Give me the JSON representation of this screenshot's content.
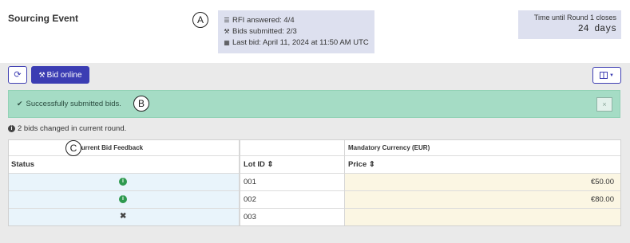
{
  "page_title": "Sourcing Event",
  "callouts": {
    "a": "A",
    "b": "B",
    "c": "C"
  },
  "summary": {
    "rfi": "RFI answered: 4/4",
    "bids": "Bids submitted: 2/3",
    "last_bid": "Last bid: April 11, 2024 at 11:50 AM UTC"
  },
  "timer": {
    "label": "Time until Round 1 closes",
    "value": "24 days"
  },
  "toolbar": {
    "bid_online_label": "Bid online"
  },
  "alert": {
    "message": "Successfully submitted bids.",
    "close_symbol": "×"
  },
  "info_note": "2 bids changed in current round.",
  "table": {
    "group_headers": {
      "feedback": "Current Bid Feedback",
      "currency": "Mandatory Currency (EUR)"
    },
    "columns": {
      "status": "Status",
      "lot_id": "Lot ID ⇕",
      "price": "Price ⇕"
    },
    "rows": [
      {
        "status": "ok",
        "lot_id": "001",
        "price": "€50.00"
      },
      {
        "status": "ok",
        "lot_id": "002",
        "price": "€80.00"
      },
      {
        "status": "none",
        "lot_id": "003",
        "price": ""
      }
    ]
  },
  "icons": {
    "list": "list-icon",
    "gavel": "gavel-icon",
    "calendar": "calendar-icon",
    "refresh": "refresh-icon",
    "columns": "columns-icon",
    "check": "check-icon",
    "info": "info-icon",
    "close": "close-icon",
    "x": "x-mark-icon"
  },
  "colors": {
    "primary": "#3b3db3",
    "panel": "#dde0ef",
    "success_bg": "#a5dcc5",
    "status_bg": "#e9f4fb",
    "price_bg": "#fbf6e3",
    "ok_green": "#2e9a4f"
  }
}
